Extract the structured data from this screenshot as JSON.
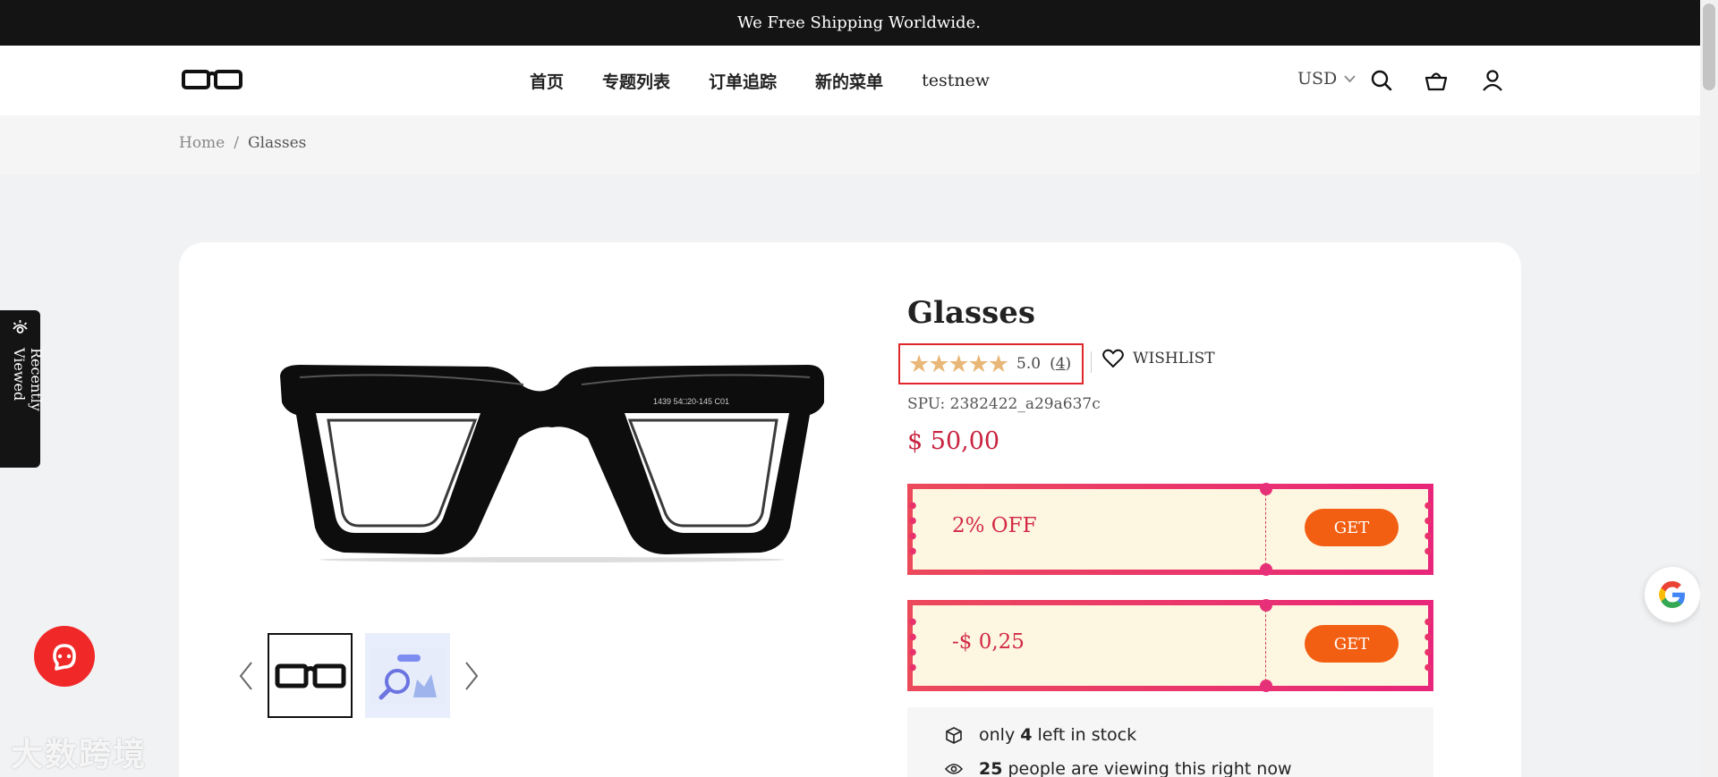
{
  "announcement": {
    "text": "We Free Shipping Worldwide."
  },
  "header": {
    "logo_icon": "glasses-logo",
    "nav": [
      {
        "label": "首页"
      },
      {
        "label": "专题列表"
      },
      {
        "label": "订单追踪"
      },
      {
        "label": "新的菜单"
      },
      {
        "label": "testnew"
      }
    ],
    "currency": "USD",
    "icons": [
      "search-icon",
      "cart-icon",
      "account-icon"
    ]
  },
  "breadcrumb": {
    "items": [
      "Home",
      "Glasses"
    ],
    "separator": "/"
  },
  "product": {
    "title": "Glasses",
    "rating": {
      "value": 5.0,
      "value_text": "5.0",
      "count": "4",
      "stars": 5
    },
    "wishlist_label": "WISHLIST",
    "spu": "SPU: 2382422_a29a637c",
    "price": "$ 50,00",
    "coupons": [
      {
        "label": "2% OFF",
        "button": "GET"
      },
      {
        "label": "-$ 0,25",
        "button": "GET"
      }
    ],
    "stock": {
      "line1_prefix": "only",
      "line1_count": "4",
      "line1_suffix": "left in stock",
      "line2_count": "25",
      "line2_suffix": "people are viewing this right now"
    },
    "frame_print": "1439 54□20-145 C01"
  },
  "recently_viewed": {
    "label": "Recently Viewed"
  },
  "watermark": {
    "text": "大数跨境"
  },
  "colors": {
    "accent": "#c8223f",
    "coupon_button": "#f25f12",
    "rating_star": "#e9b777",
    "highlight_box": "#e0252b"
  }
}
